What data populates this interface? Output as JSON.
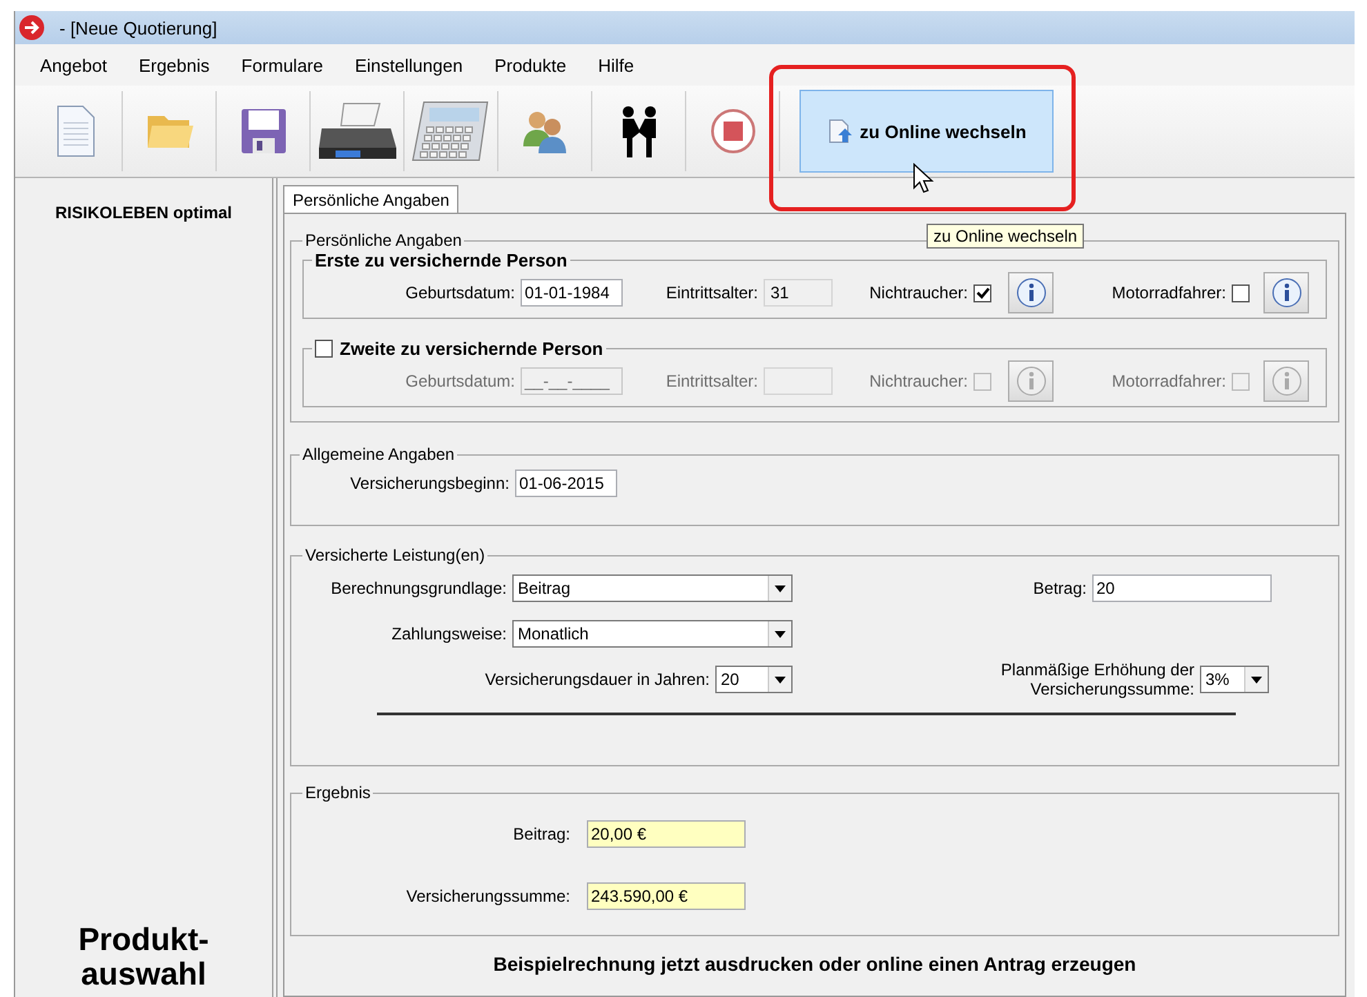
{
  "window": {
    "title": "- [Neue Quotierung]"
  },
  "menu": [
    "Angebot",
    "Ergebnis",
    "Formulare",
    "Einstellungen",
    "Produkte",
    "Hilfe"
  ],
  "toolbar": {
    "buttons": [
      {
        "kind": "document"
      },
      {
        "kind": "folder"
      },
      {
        "kind": "save"
      },
      {
        "kind": "printer"
      },
      {
        "kind": "calculator"
      },
      {
        "kind": "people"
      },
      {
        "kind": "handshake"
      },
      {
        "kind": "stop"
      }
    ],
    "online_button": {
      "label": "zu Online wechseln",
      "hovered": true,
      "highlighted": true
    },
    "tooltip": "zu Online wechseln"
  },
  "sidebar": {
    "product": "RISIKOLEBEN optimal",
    "footer": [
      "Produkt-",
      "auswahl"
    ]
  },
  "tabs": [
    {
      "label": "Persönliche Angaben",
      "selected": true
    }
  ],
  "personal": {
    "title": "Persönliche Angaben",
    "persons": [
      {
        "kind": "fixed",
        "title": "Erste zu versichernde Person",
        "enabled": true,
        "birth_label": "Geburtsdatum:",
        "birth_value": "01-01-1984",
        "age_label": "Eintrittsalter:",
        "age_value": "31",
        "nonsmoker_label": "Nichtraucher:",
        "nonsmoker": true,
        "motorcycle_label": "Motorradfahrer:",
        "motorcycle": false
      },
      {
        "kind": "optional",
        "title": "Zweite zu versichernde Person",
        "checked": false,
        "enabled": false,
        "birth_label": "Geburtsdatum:",
        "birth_value": "__-__-____",
        "age_label": "Eintrittsalter:",
        "nonsmoker_label": "Nichtraucher:",
        "nonsmoker": false,
        "motorcycle_label": "Motorradfahrer:",
        "motorcycle": false
      }
    ]
  },
  "general": {
    "title": "Allgemeine Angaben",
    "start_label": "Versicherungsbeginn:",
    "start_value": "01-06-2015"
  },
  "insured": {
    "title": "Versicherte Leistung(en)",
    "basis_label": "Berechnungsgrundlage:",
    "basis_value": "Beitrag",
    "amount_label": "Betrag:",
    "amount_value": "20",
    "payment_label": "Zahlungsweise:",
    "payment_value": "Monatlich",
    "duration_label": "Versicherungsdauer in Jahren:",
    "duration_value": "20",
    "increase_label": [
      "Planmäßige Erhöhung der",
      "Versicherungssumme:"
    ],
    "increase_value": "3%"
  },
  "result": {
    "title": "Ergebnis",
    "rows": [
      {
        "label": "Beitrag:",
        "value": "20,00 €"
      },
      {
        "label": "Versicherungssumme:",
        "value": "243.590,00 €"
      }
    ]
  },
  "footer": "Beispielrechnung jetzt ausdrucken oder online einen Antrag erzeugen"
}
